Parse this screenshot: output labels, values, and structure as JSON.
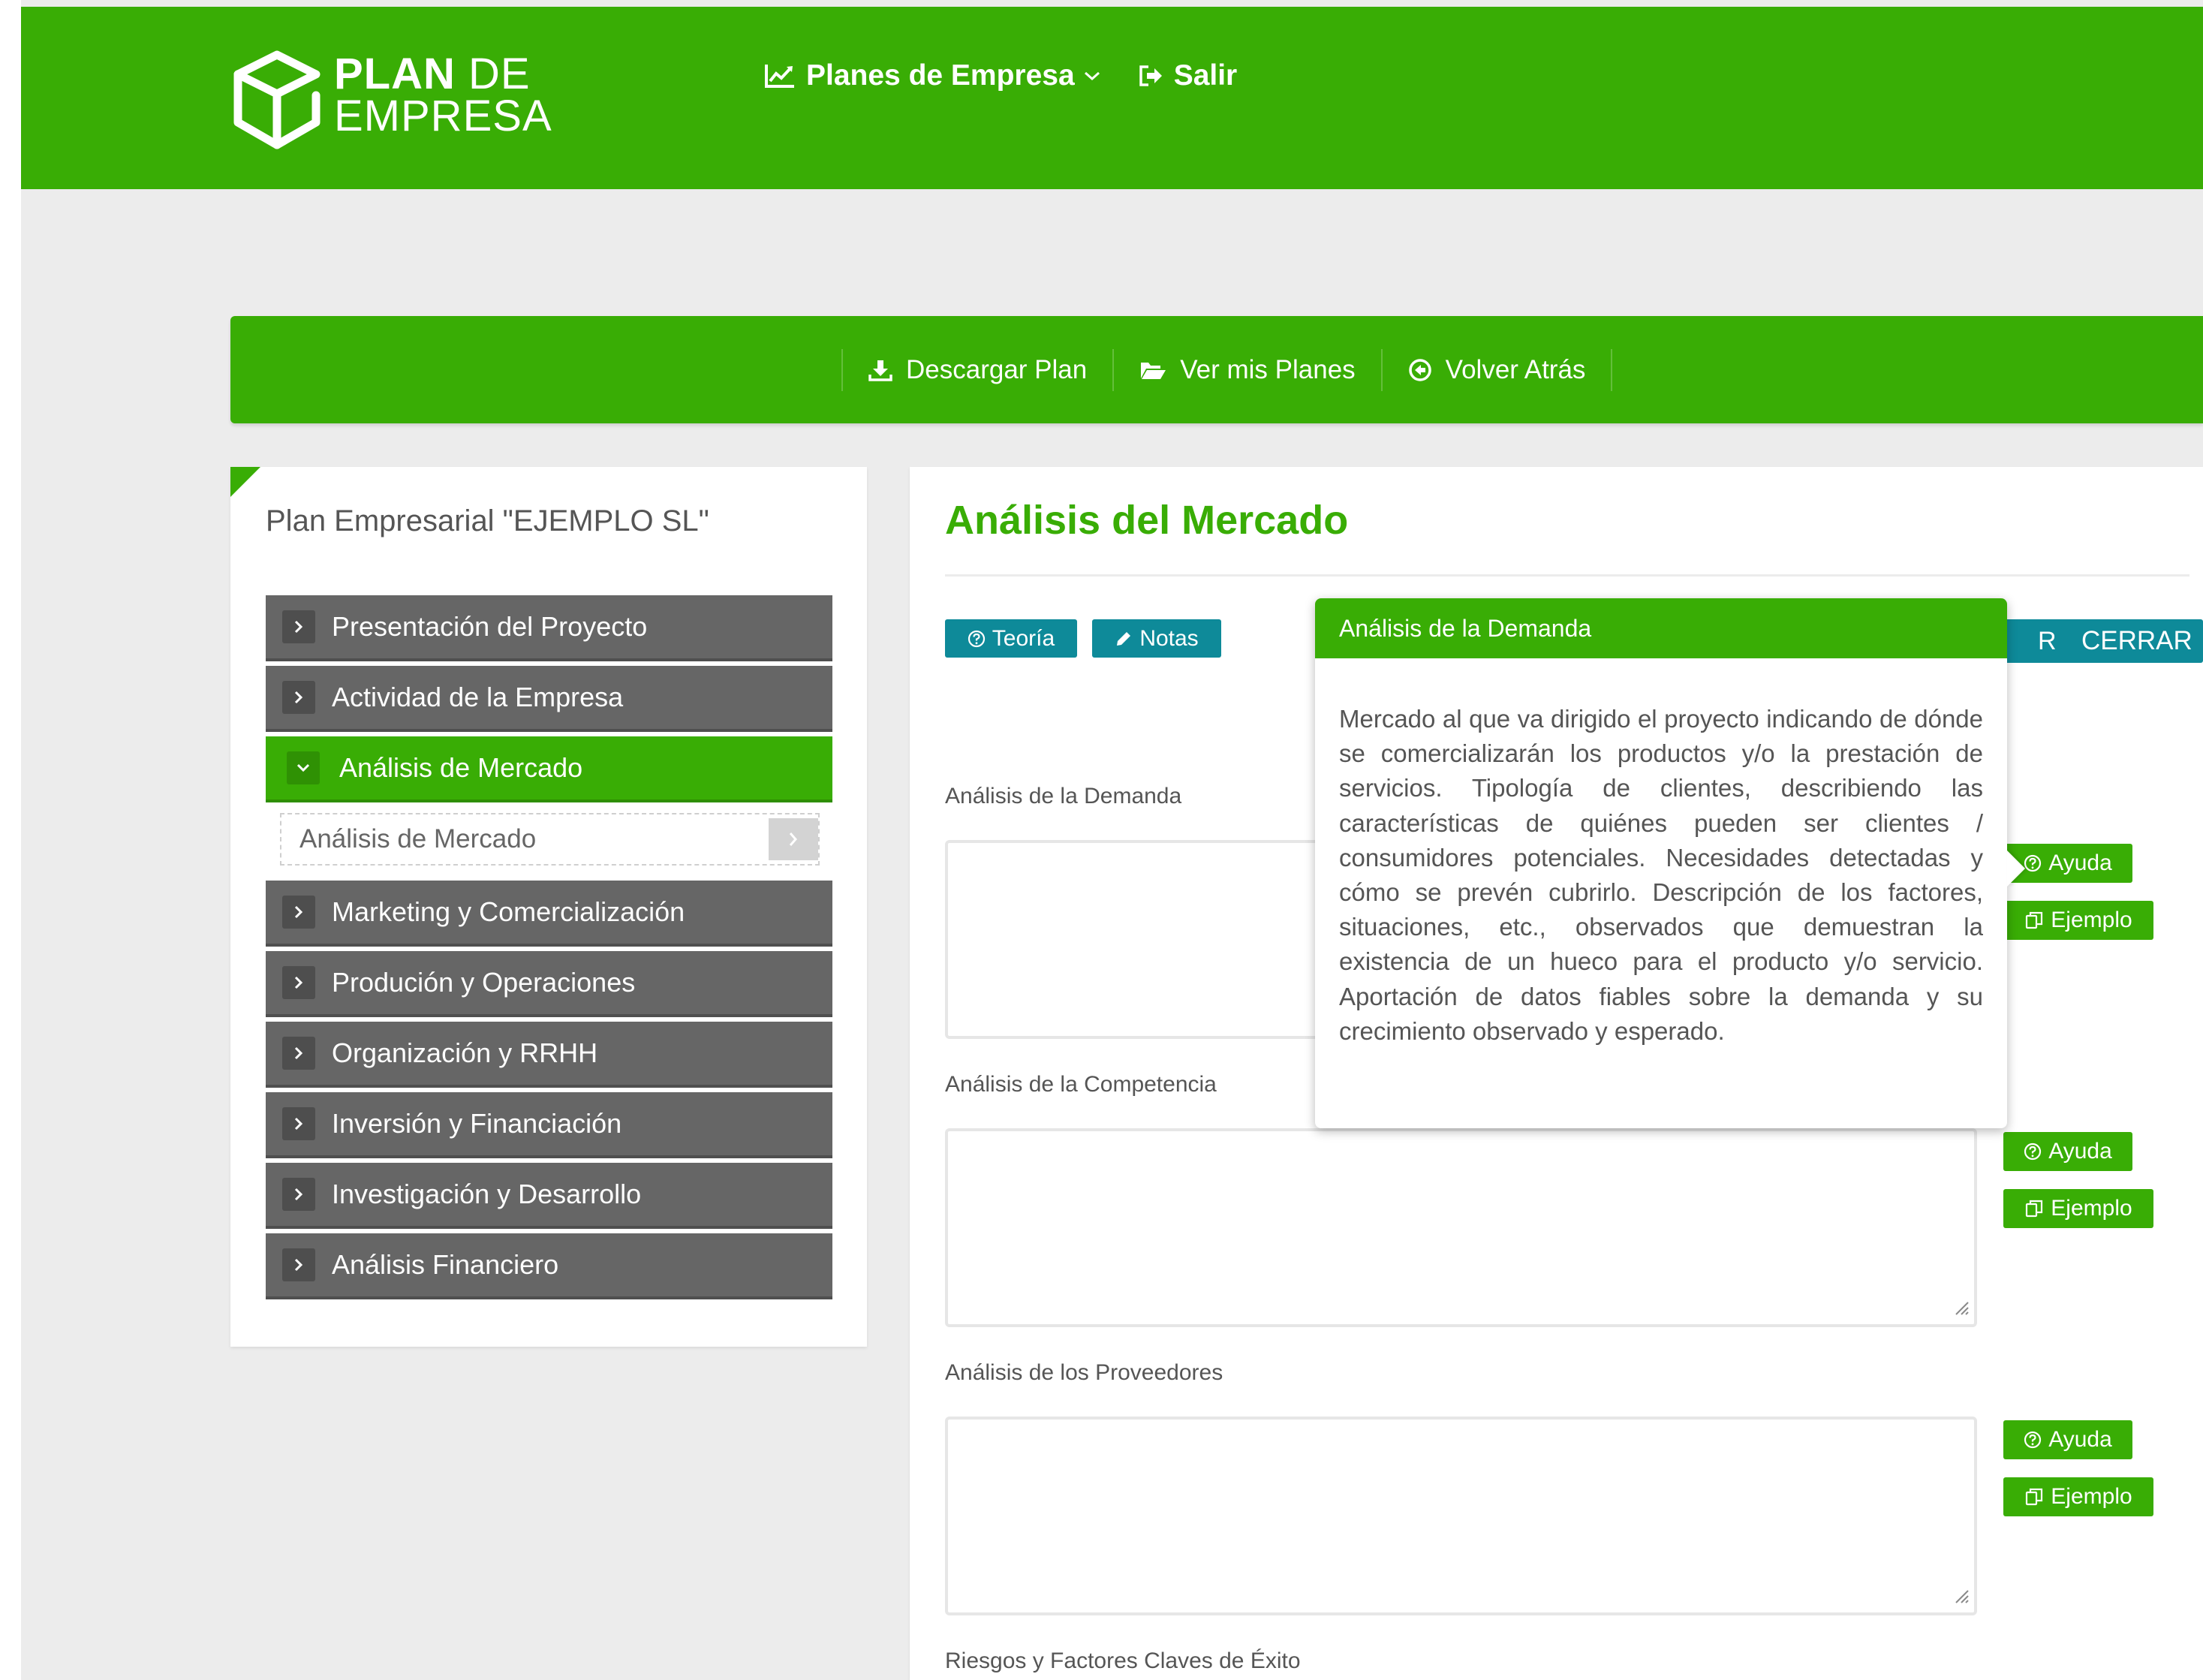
{
  "brand": {
    "line1_bold": "PLAN",
    "line1_light": "DE",
    "line2": "EMPRESA"
  },
  "topnav": {
    "plans_label": "Planes de Empresa",
    "logout_label": "Salir"
  },
  "actionbar": {
    "download": "Descargar Plan",
    "my_plans": "Ver mis Planes",
    "back": "Volver Atrás"
  },
  "sidebar": {
    "title": "Plan Empresarial \"EJEMPLO SL\"",
    "items": [
      {
        "label": "Presentación del Proyecto"
      },
      {
        "label": "Actividad de la Empresa"
      },
      {
        "label": "Análisis de Mercado"
      },
      {
        "label": "Marketing y Comercialización"
      },
      {
        "label": "Produción y Operaciones"
      },
      {
        "label": "Organización y RRHH"
      },
      {
        "label": "Inversión y Financiación"
      },
      {
        "label": "Investigación y Desarrollo"
      },
      {
        "label": "Análisis Financiero"
      }
    ],
    "submenu_label": "Análisis de Mercado"
  },
  "main": {
    "title": "Análisis del Mercado",
    "teoria": "Teoría",
    "notas": "Notas",
    "hidden_btn_fragment": "R",
    "cerrar": "CERRAR",
    "ayuda": "Ayuda",
    "ejemplo": "Ejemplo",
    "fields": [
      {
        "label": "Análisis de la Demanda"
      },
      {
        "label": "Análisis de la Competencia"
      },
      {
        "label": "Análisis de los Proveedores"
      },
      {
        "label": "Riesgos y Factores Claves de Éxito"
      }
    ]
  },
  "popover": {
    "title": "Análisis de la Demanda",
    "body": "Mercado al que va dirigido el proyecto indicando de dónde se comercializarán los productos y/o la prestación de servicios. Tipología de clientes, describiendo las características de quiénes pueden ser clientes / consumidores potenciales. Necesidades detectadas y cómo se prevén cubrirlo. Descripción de los factores, situaciones, etc., observados que demuestran la existencia de un hueco para el producto y/o servicio. Aportación de datos fiables sobre la demanda y su crecimiento observado y esperado."
  },
  "colors": {
    "brand_green": "#39ad05",
    "teal": "#0e8a99",
    "menu_grey": "#666666"
  },
  "icons": [
    "logo-box-icon",
    "chart-line-icon",
    "chevron-down-icon",
    "sign-out-icon",
    "download-icon",
    "folder-open-icon",
    "arrow-circle-left-icon",
    "chevron-right-icon",
    "question-circle-icon",
    "pencil-icon",
    "copy-icon",
    "resize-grip-icon"
  ]
}
